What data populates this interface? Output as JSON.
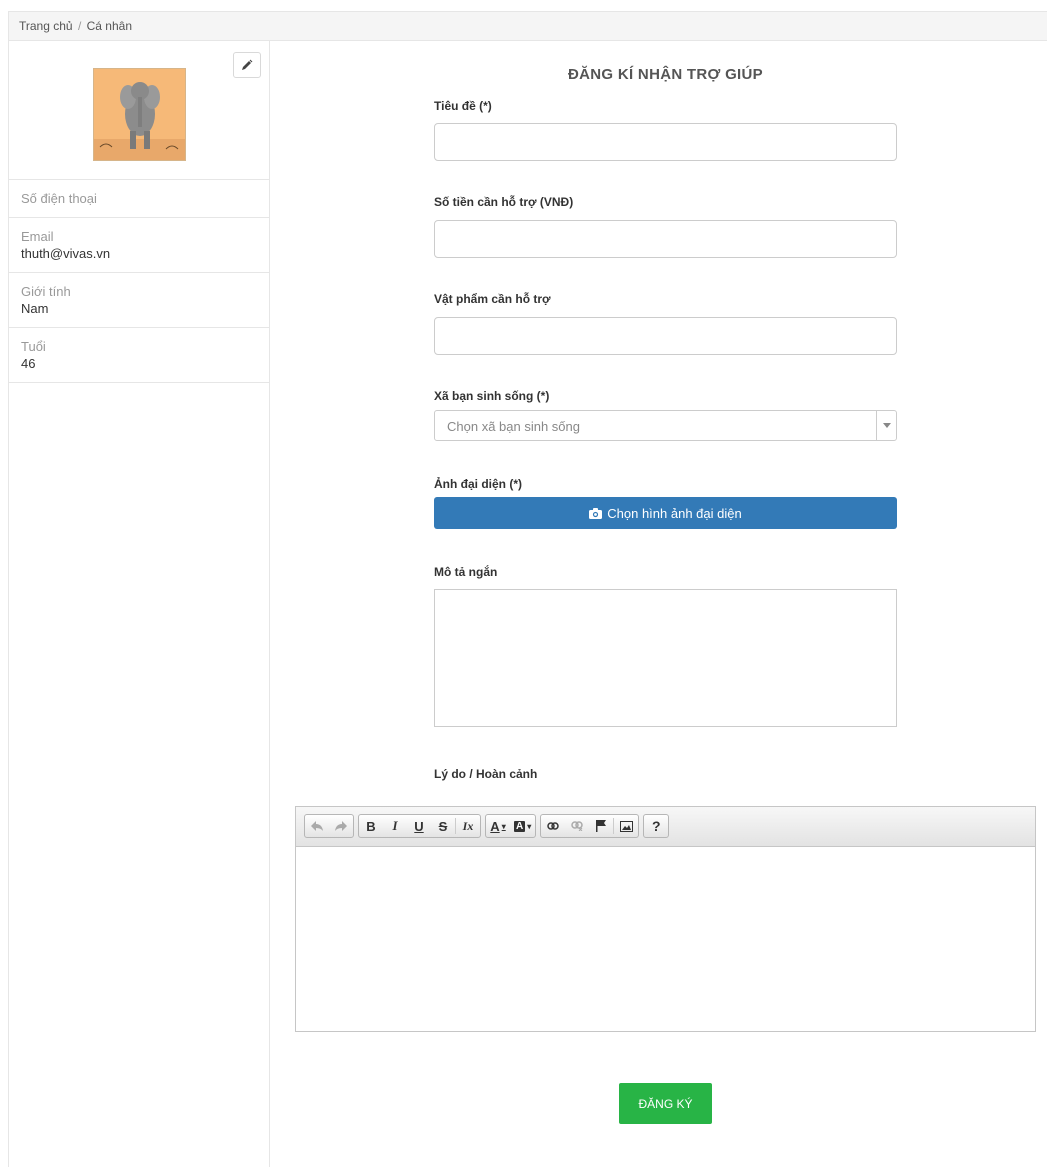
{
  "breadcrumb": {
    "home": "Trang chủ",
    "separator": "/",
    "current": "Cá nhân"
  },
  "profile": {
    "edit_icon": "pencil-icon",
    "fields": [
      {
        "label": "Số điện thoại",
        "value": ""
      },
      {
        "label": "Email",
        "value": "thuth@vivas.vn"
      },
      {
        "label": "Giới tính",
        "value": "Nam"
      },
      {
        "label": "Tuổi",
        "value": "46"
      }
    ]
  },
  "form": {
    "title": "ĐĂNG KÍ NHẬN TRỢ GIÚP",
    "title_label": "Tiêu đề (*)",
    "amount_label": "Số tiền cần hỗ trợ (VNĐ)",
    "items_label": "Vật phẩm cần hỗ trợ",
    "commune_label": "Xã bạn sinh sống (*)",
    "commune_placeholder": "Chọn xã bạn sinh sống",
    "avatar_label": "Ảnh đại diện (*)",
    "avatar_button": "Chọn hình ảnh đại diện",
    "short_desc_label": "Mô tả ngắn",
    "reason_label": "Lý do / Hoàn cảnh",
    "submit": "ĐĂNG KÝ"
  },
  "toolbar": {
    "bold": "B",
    "italic": "I",
    "underline": "U",
    "strike": "S",
    "clear": "Ix",
    "text_color": "A",
    "bg_color": "A",
    "help": "?"
  },
  "colors": {
    "primary": "#337ab7",
    "success": "#28b446"
  }
}
